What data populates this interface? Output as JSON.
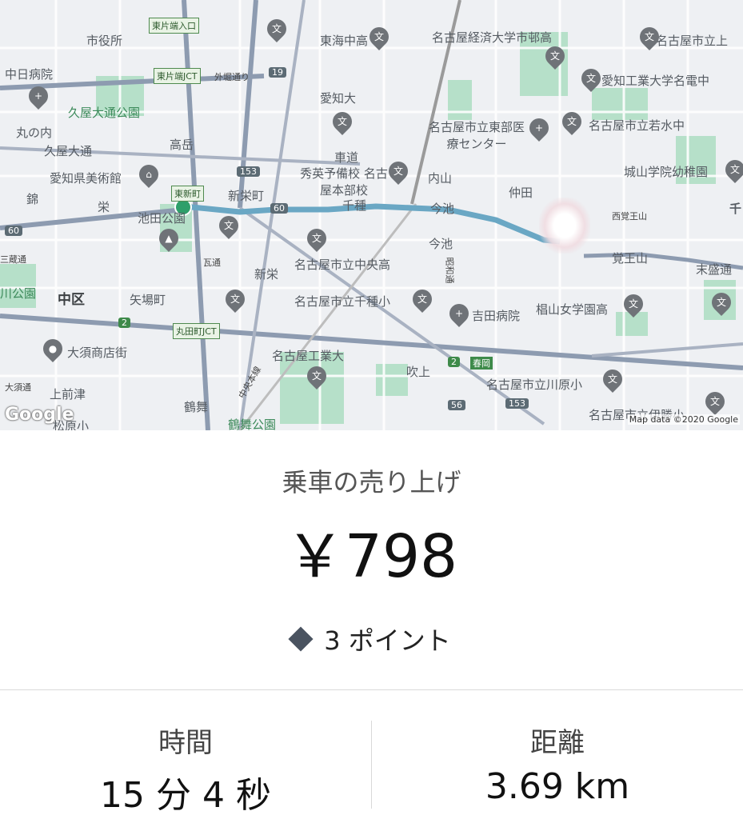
{
  "map": {
    "labels": {
      "shiyakusho": "市役所",
      "chunichi": "中日病院",
      "hisaya_park": "久屋大通公園",
      "marunouchi": "丸の内",
      "hisaya_st": "久屋大通",
      "takaoka": "高岳",
      "aichi_museum": "愛知県美術館",
      "nishiki": "錦",
      "sakae": "栄",
      "ikeda_park": "池田公園",
      "shinsakae_st": "新栄町",
      "higashishinmachi": "東新町",
      "naka_ku": "中区",
      "yabacho": "矢場町",
      "osu": "大須商店街",
      "kamimaezu": "上前津",
      "tsurumai": "鶴舞",
      "tsurumai_park": "鶴舞公園",
      "osu2": "大須通",
      "kamimaezu2": "松原小",
      "tokai_hs": "東海中高",
      "aichi_u": "愛知大",
      "keizai": "名古屋経済大学市邨高",
      "aichi_kogyo": "愛知工業大学名電中",
      "higashi_hospital": "名古屋市立東部医療センター",
      "wakamizu": "名古屋市立若水中",
      "shirayama": "城山学院幼稚園",
      "kurumamichi": "車道",
      "shuei": "秀英予備校 名古屋本部校",
      "uchiyama": "内山",
      "chikusa": "千種",
      "imaike": "今池",
      "imaike2": "今池",
      "nakata": "仲田",
      "nishiyamamon": "西覚王山",
      "kakuozan": "覚王山",
      "suemori": "末盛通",
      "gawara": "瓦通",
      "shinsakae": "新栄",
      "chuo_hs": "名古屋市立中央高",
      "chikusa_es": "名古屋市立千種小",
      "yoshida": "吉田病院",
      "sugiyama": "椙山女学園高",
      "kogyo_u": "名古屋工業大",
      "fukiage": "吹上",
      "harukaoka": "春岡",
      "kawahara": "名古屋市立川原小",
      "ikeshita": "名古屋市立伊勝小",
      "nagoya_tachi": "名古屋市立上",
      "sen": "千",
      "sanjo": "三蔵通",
      "kawa_park": "川公園",
      "gaibori": "外堀通り",
      "higashikata_entry": "東片端入口",
      "higashikata_jct": "東片端JCT",
      "maruta_jct": "丸田町JCT",
      "chuo_line": "中央本線",
      "route19": "19",
      "route153a": "153",
      "route60a": "60",
      "route60b": "60",
      "route2a": "2",
      "route2b": "2",
      "route56": "56",
      "route153b": "153",
      "ohashi": "大須通",
      "shokatsu": "昭和通"
    },
    "google_logo": "Google",
    "copyright": "Map data ©2020 Google"
  },
  "summary": {
    "label": "乗車の売り上げ",
    "amount": "￥798",
    "points_label": "3 ポイント"
  },
  "stats": {
    "time_label": "時間",
    "time_value": "15 分 4 秒",
    "distance_label": "距離",
    "distance_value": "3.69 km"
  },
  "colors": {
    "route": "#6aa7c4",
    "origin_marker": "#2e9f6a",
    "park": "#b6e0c9",
    "highway": "#8d9bb0",
    "poi": "#6f7378"
  }
}
